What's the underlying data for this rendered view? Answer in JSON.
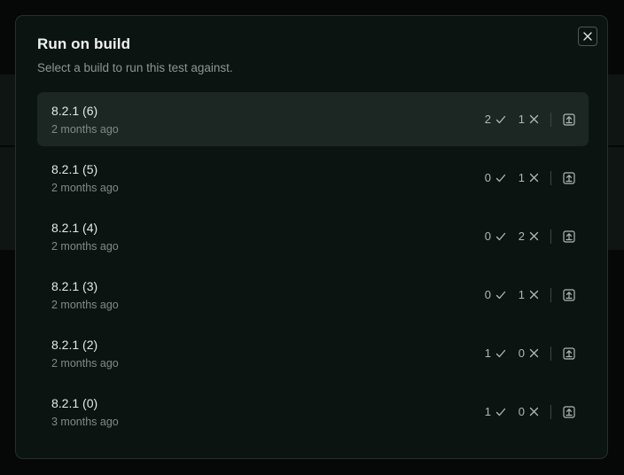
{
  "dialog": {
    "title": "Run on build",
    "subtitle": "Select a build to run this test against."
  },
  "icons": {
    "close": "close-icon",
    "passed": "check-icon",
    "failed": "x-icon",
    "run": "upload-icon"
  },
  "colors": {
    "selected_row": "#1c2724",
    "modal_bg": "#0c1412"
  },
  "builds": [
    {
      "name": "8.2.1 (6)",
      "age": "2 months ago",
      "passed": "2",
      "failed": "1",
      "selected": true
    },
    {
      "name": "8.2.1 (5)",
      "age": "2 months ago",
      "passed": "0",
      "failed": "1",
      "selected": false
    },
    {
      "name": "8.2.1 (4)",
      "age": "2 months ago",
      "passed": "0",
      "failed": "2",
      "selected": false
    },
    {
      "name": "8.2.1 (3)",
      "age": "2 months ago",
      "passed": "0",
      "failed": "1",
      "selected": false
    },
    {
      "name": "8.2.1 (2)",
      "age": "2 months ago",
      "passed": "1",
      "failed": "0",
      "selected": false
    },
    {
      "name": "8.2.1 (0)",
      "age": "3 months ago",
      "passed": "1",
      "failed": "0",
      "selected": false
    }
  ]
}
